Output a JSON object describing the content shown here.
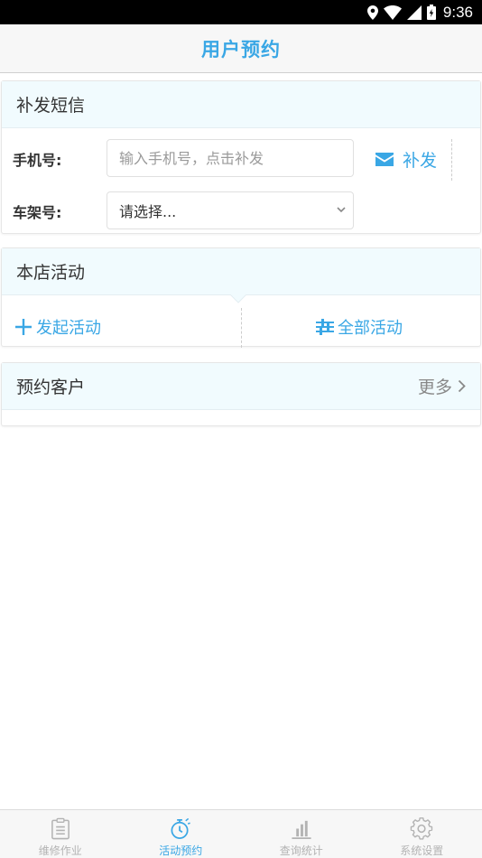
{
  "status_bar": {
    "time": "9:36"
  },
  "header": {
    "title": "用户预约"
  },
  "sms_card": {
    "title": "补发短信",
    "phone_label": "手机号:",
    "phone_placeholder": "输入手机号，点击补发",
    "phone_value": "",
    "resend_label": "补发",
    "frame_label": "车架号:",
    "frame_selected": "请选择..."
  },
  "activity_card": {
    "title": "本店活动",
    "start_label": "发起活动",
    "all_label": "全部活动"
  },
  "reserve_card": {
    "title": "预约客户",
    "more_label": "更多"
  },
  "bottom_nav": {
    "items": [
      {
        "label": "维修作业",
        "icon": "clipboard-icon"
      },
      {
        "label": "活动预约",
        "icon": "stopwatch-icon"
      },
      {
        "label": "查询统计",
        "icon": "bar-chart-icon"
      },
      {
        "label": "系统设置",
        "icon": "gear-icon"
      }
    ]
  },
  "colors": {
    "accent": "#3aa7e5",
    "header_bg": "#f1fbfe",
    "muted": "#b3b3b3"
  }
}
